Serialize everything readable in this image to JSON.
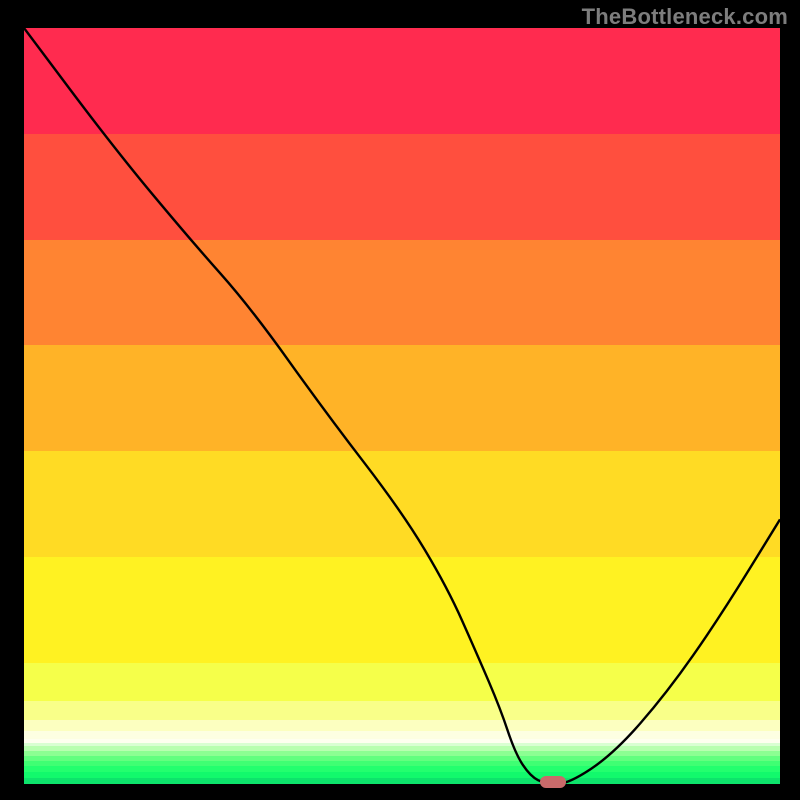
{
  "watermark": "TheBottleneck.com",
  "chart_data": {
    "type": "line",
    "title": "",
    "xlabel": "",
    "ylabel": "",
    "xlim": [
      0,
      100
    ],
    "ylim": [
      0,
      100
    ],
    "x": [
      0,
      12,
      22,
      30,
      40,
      50,
      56,
      60,
      63,
      65,
      67,
      69,
      72,
      78,
      85,
      92,
      100
    ],
    "values": [
      100,
      84,
      72,
      63,
      49,
      36,
      26,
      17,
      10,
      4,
      1,
      0,
      0,
      4,
      12,
      22,
      35
    ],
    "annotations": [
      {
        "type": "marker",
        "x": 70,
        "y": 0,
        "color": "#c96a6a"
      }
    ],
    "background_bands": [
      {
        "y0": 86,
        "y1": 100,
        "color": "#ff2b4f"
      },
      {
        "y0": 72,
        "y1": 86,
        "color": "#ff4f3e"
      },
      {
        "y0": 58,
        "y1": 72,
        "color": "#ff8432"
      },
      {
        "y0": 44,
        "y1": 58,
        "color": "#ffb327"
      },
      {
        "y0": 30,
        "y1": 44,
        "color": "#ffdb24"
      },
      {
        "y0": 16,
        "y1": 30,
        "color": "#fff222"
      },
      {
        "y0": 11,
        "y1": 16,
        "color": "#f5ff4a"
      },
      {
        "y0": 8.5,
        "y1": 11,
        "color": "#f9ff89"
      },
      {
        "y0": 7,
        "y1": 8.5,
        "color": "#fcffc0"
      },
      {
        "y0": 6,
        "y1": 7,
        "color": "#fdffe2"
      },
      {
        "y0": 5.4,
        "y1": 6,
        "color": "#feffef"
      },
      {
        "y0": 5,
        "y1": 5.4,
        "color": "#d9ffd2"
      },
      {
        "y0": 4.4,
        "y1": 5,
        "color": "#b8ffb0"
      },
      {
        "y0": 3.7,
        "y1": 4.4,
        "color": "#8cff92"
      },
      {
        "y0": 3.0,
        "y1": 3.7,
        "color": "#62ff7f"
      },
      {
        "y0": 2.3,
        "y1": 3.0,
        "color": "#3fff73"
      },
      {
        "y0": 1.6,
        "y1": 2.3,
        "color": "#23ff6e"
      },
      {
        "y0": 0.8,
        "y1": 1.6,
        "color": "#12f96c"
      },
      {
        "y0": 0,
        "y1": 0.8,
        "color": "#0de36b"
      }
    ]
  },
  "colors": {
    "curve": "#000000",
    "marker": "#c96a6a",
    "frame_bg": "#000000"
  }
}
